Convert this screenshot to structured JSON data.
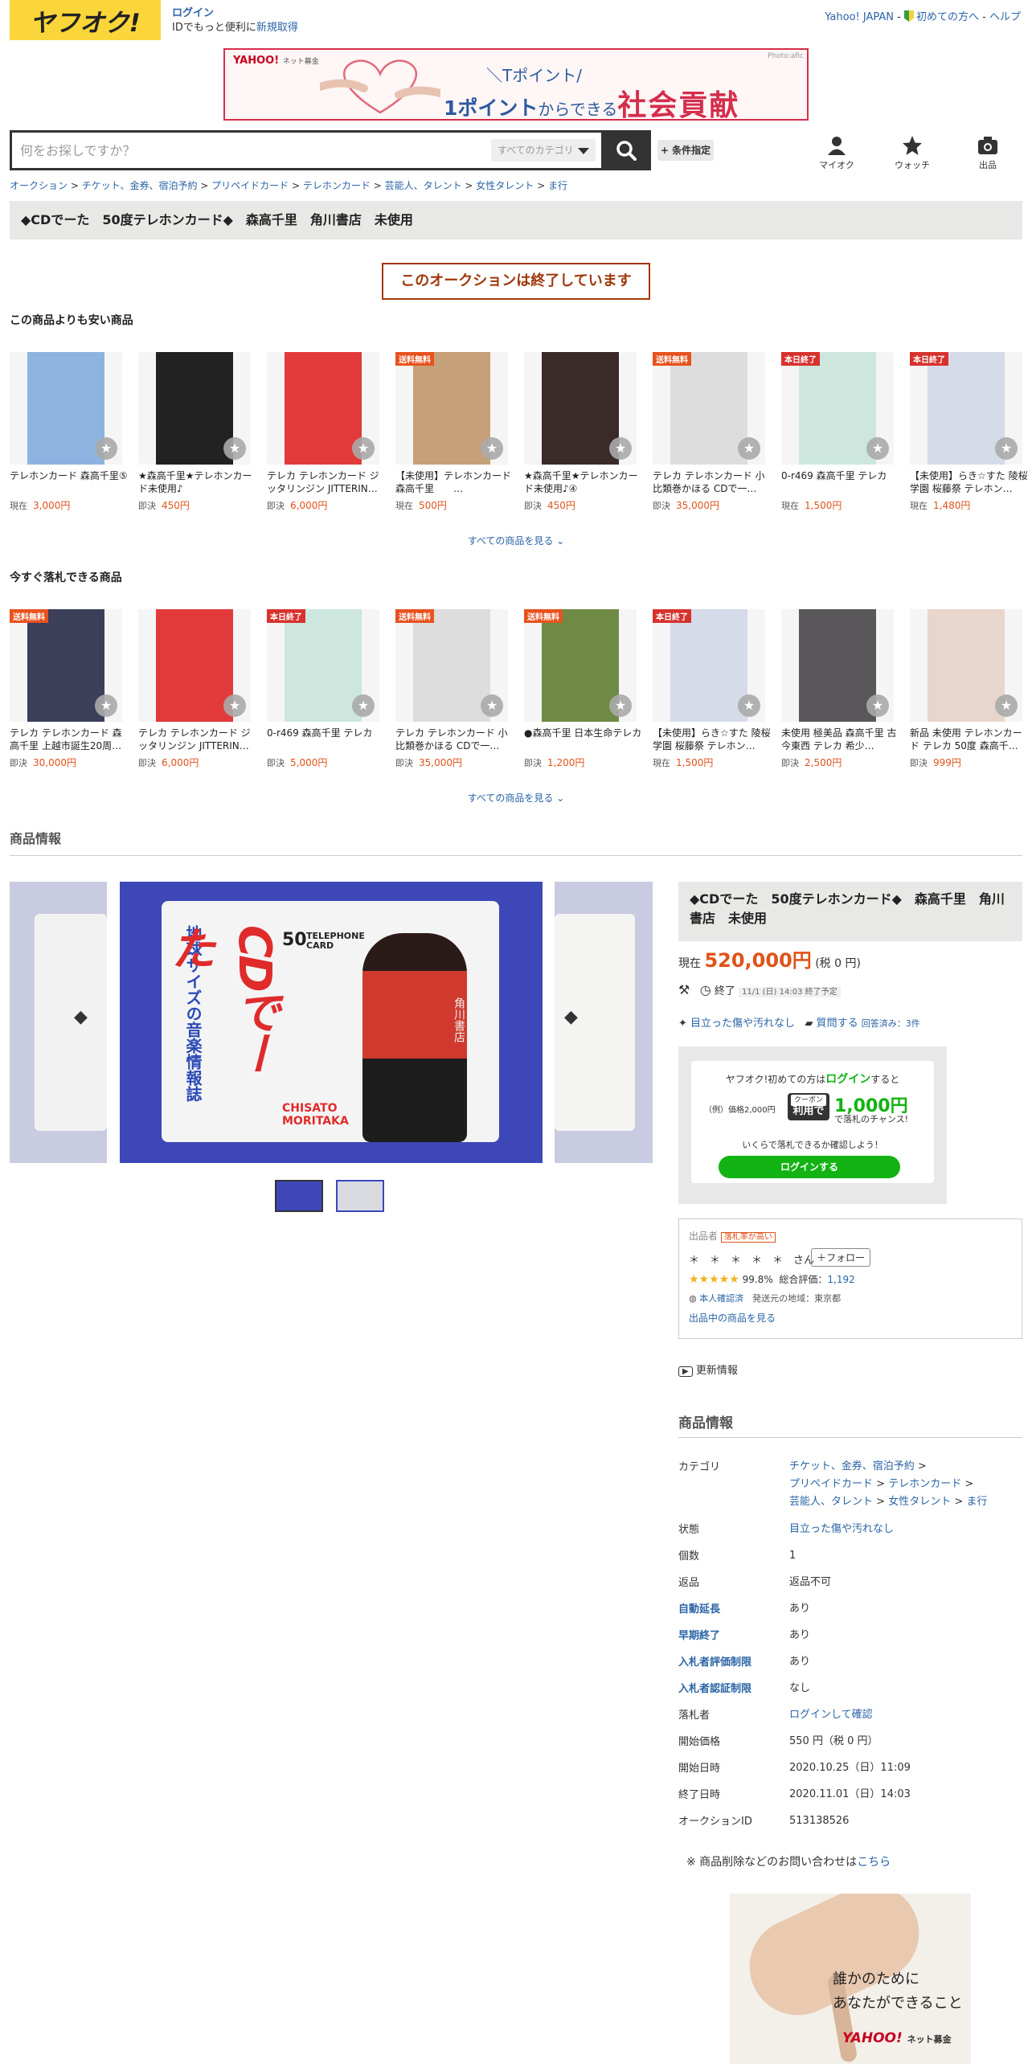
{
  "header": {
    "logo": "ヤフオク!",
    "login": "ログイン",
    "login_sub_prefix": "IDでもっと便利に",
    "signup": "新規取得",
    "yahoo_japan": "Yahoo! JAPAN",
    "sep": "-",
    "beginner": "初めての方へ",
    "help": "ヘルプ"
  },
  "banner": {
    "brand": "YAHOO!",
    "brand_sub": "ネット募金",
    "photo": "Photo:afic",
    "line1": "＼Tポイント/",
    "line2_a": "1ポイント",
    "line2_b": "からできる",
    "line2_c": "社会貢献"
  },
  "search": {
    "placeholder": "何をお探しですか？",
    "category": "すべてのカテゴリ",
    "condition": "+ 条件指定",
    "myauction": "マイオク",
    "watch": "ウォッチ",
    "sell": "出品"
  },
  "breadcrumb": [
    "オークション",
    "チケット、金券、宿泊予約",
    "プリペイドカード",
    "テレホンカード",
    "芸能人、タレント",
    "女性タレント",
    "ま行"
  ],
  "title": "◆CDでーた　50度テレホンカード◆　森高千里　角川書店　未使用",
  "ended": "このオークションは終了しています",
  "cheaper": {
    "heading": "この商品よりも安い商品",
    "items": [
      {
        "badge": "",
        "name": "テレホンカード 森高千里⑤",
        "ptype": "現在",
        "price": "3,000円",
        "color": "#8db4e0"
      },
      {
        "badge": "",
        "name": "★森高千里★テレホンカード未使用♪",
        "ptype": "即決",
        "price": "450円",
        "color": "#222"
      },
      {
        "badge": "",
        "name": "テレカ テレホンカード ジッタリンジン JITTERIN…",
        "ptype": "即決",
        "price": "6,000円",
        "color": "#e23a3a"
      },
      {
        "badge": "送料無料",
        "name": "【未使用】テレホンカード　森高千里　　…",
        "ptype": "現在",
        "price": "500円",
        "color": "#c6a078"
      },
      {
        "badge": "",
        "name": "★森高千里★テレホンカード未使用♪④",
        "ptype": "即決",
        "price": "450円",
        "color": "#3a2a2a"
      },
      {
        "badge": "送料無料",
        "name": "テレカ テレホンカード 小比類巻かほる CDで一…",
        "ptype": "即決",
        "price": "35,000円",
        "color": "#ddd"
      },
      {
        "badge": "本日終了",
        "name": "0-r469 森高千里 テレカ",
        "ptype": "現在",
        "price": "1,500円",
        "color": "#cde6de"
      },
      {
        "badge": "本日終了",
        "name": "【未使用】らき☆すた 陵桜学園 桜藤祭 テレホン…",
        "ptype": "現在",
        "price": "1,480円",
        "color": "#d6dbea"
      }
    ]
  },
  "now": {
    "heading": "今すぐ落札できる商品",
    "items": [
      {
        "badge": "送料無料",
        "name": "テレカ テレホンカード 森高千里 上越市誕生20周…",
        "ptype": "即決",
        "price": "30,000円",
        "color": "#3b3f5a"
      },
      {
        "badge": "",
        "name": "テレカ テレホンカード ジッタリンジン JITTERIN…",
        "ptype": "即決",
        "price": "6,000円",
        "color": "#e23a3a"
      },
      {
        "badge": "本日終了",
        "name": "0-r469 森高千里 テレカ",
        "ptype": "即決",
        "price": "5,000円",
        "color": "#cde6de"
      },
      {
        "badge": "送料無料",
        "name": "テレカ テレホンカード 小比類巻かほる CDで一…",
        "ptype": "即決",
        "price": "35,000円",
        "color": "#ddd"
      },
      {
        "badge": "送料無料",
        "name": "●森高千里 日本生命テレカ",
        "ptype": "即決",
        "price": "1,200円",
        "color": "#6f8a45"
      },
      {
        "badge": "本日終了",
        "name": "【未使用】らき☆すた 陵桜学園 桜藤祭 テレホン…",
        "ptype": "現在",
        "price": "1,500円",
        "color": "#d6dbea"
      },
      {
        "badge": "",
        "name": "未使用 極美品 森高千里 古今東西 テレカ 希少…",
        "ptype": "即決",
        "price": "2,500円",
        "color": "#59575a"
      },
      {
        "badge": "",
        "name": "新品 未使用 テレホンカード テレカ 50度 森高千…",
        "ptype": "即決",
        "price": "999円",
        "color": "#e8d6cc"
      }
    ]
  },
  "see_all": "すべての商品を見る",
  "product_info_heading": "商品情報",
  "main_image": {
    "brand": "CDでーた",
    "label_a": "50",
    "label_b": "TELEPHONE CARD",
    "vertical": "地球サイズの音楽情報誌",
    "name_a": "CHISATO",
    "name_b": "MORITAKA",
    "publisher": "角川書店"
  },
  "right": {
    "price_label": "現在",
    "price": "520,000円",
    "tax": "(税 0 円)",
    "end_label": "終了",
    "end_time": "11/1 (日) 14:03 終了予定",
    "condition": "目立った傷や汚れなし",
    "question": "質問する",
    "answered": "回答済み：3件",
    "coupon_line1_a": "ヤフオク!初めての方は",
    "coupon_line1_b": "ログイン",
    "coupon_line1_c": "すると",
    "coupon_example": "（例）価格2,000円",
    "coupon_tag_a": "クーポン",
    "coupon_tag_b": "利用で",
    "coupon_amount": "1,000円",
    "coupon_chance": "で落札のチャンス!",
    "coupon_line3": "いくらで落札できるか確認しよう！",
    "coupon_btn": "ログインする"
  },
  "seller": {
    "label": "出品者",
    "badge": "落札率が高い",
    "name": "＊　＊　＊　＊　＊　さん",
    "follow": "＋フォロー",
    "rate": "99.8%",
    "total_label": "総合評価：",
    "total": "1,192",
    "verified": "本人確認済",
    "region": "発送元の地域：東京都",
    "link": "出品中の商品を見る"
  },
  "update": "更新情報",
  "info": {
    "heading": "商品情報",
    "category_label": "カテゴリ",
    "category": [
      "チケット、金券、宿泊予約",
      "プリペイドカード",
      "テレホンカード",
      "芸能人、タレント",
      "女性タレント",
      "ま行"
    ],
    "rows": [
      {
        "k": "状態",
        "v": "目立った傷や汚れなし"
      },
      {
        "k": "個数",
        "v": "1"
      },
      {
        "k": "返品",
        "v": "返品不可"
      },
      {
        "k": "自動延長",
        "v": "あり"
      },
      {
        "k": "早期終了",
        "v": "あり"
      },
      {
        "k": "入札者評価制限",
        "v": "あり"
      },
      {
        "k": "入札者認証制限",
        "v": "なし"
      },
      {
        "k": "落札者",
        "v": "ログインして確認"
      },
      {
        "k": "開始価格",
        "v": "550 円（税 0 円）"
      },
      {
        "k": "開始日時",
        "v": "2020.10.25（日）11:09"
      },
      {
        "k": "終了日時",
        "v": "2020.11.01（日）14:03"
      },
      {
        "k": "オークションID",
        "v": "513138526"
      }
    ],
    "contact_a": "※ 商品削除などのお問い合わせは",
    "contact_b": "こちら"
  },
  "ad2": {
    "line1": "誰かのために",
    "line2": "あなたができること",
    "brand": "YAHOO!",
    "brand_sub": "ネット募金"
  },
  "colors": {
    "accent": "#e0531a",
    "link": "#2a64a6",
    "logo": "#fbd63a",
    "green": "#12b312"
  }
}
